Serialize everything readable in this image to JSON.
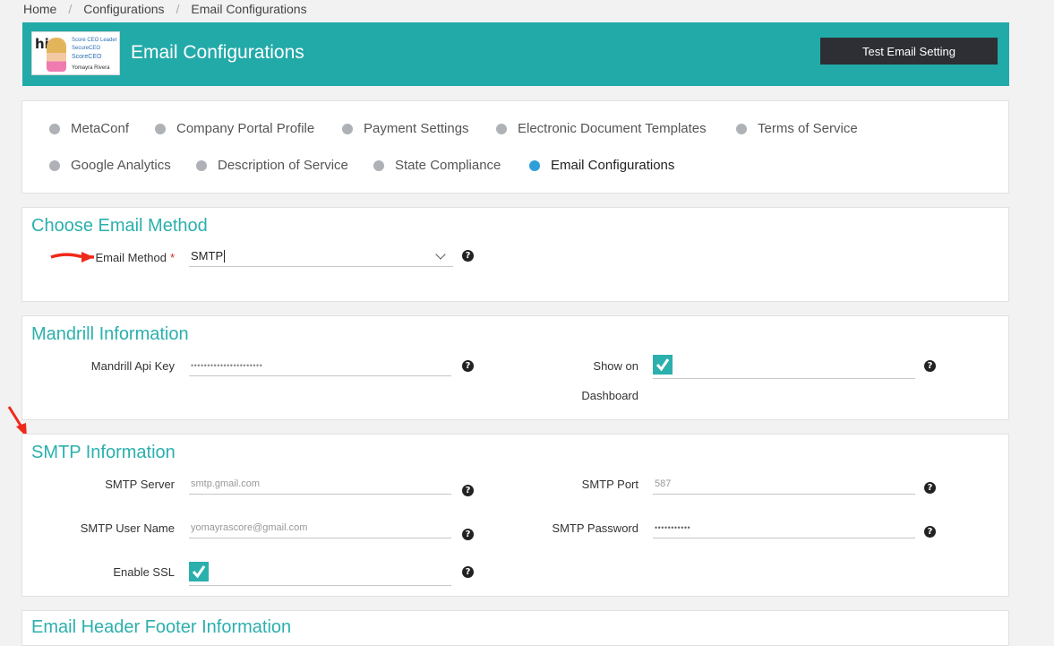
{
  "breadcrumb": {
    "home": "Home",
    "configurations": "Configurations",
    "current": "Email Configurations"
  },
  "header": {
    "title": "Email Configurations",
    "test_button": "Test Email Setting",
    "accent_color": "#22aaa8",
    "logo": {
      "hi": "hi",
      "line1": "Score CEO Leader",
      "line2": "SecureCEO",
      "line3": "ScoreCEO",
      "line4": "Yomayra Rivera"
    }
  },
  "nav": {
    "items": [
      {
        "label": "MetaConf",
        "active": false
      },
      {
        "label": "Company Portal Profile",
        "active": false
      },
      {
        "label": "Payment Settings",
        "active": false
      },
      {
        "label": "Electronic Document Templates",
        "active": false
      },
      {
        "label": "Terms of Service",
        "active": false
      },
      {
        "label": "Google Analytics",
        "active": false
      },
      {
        "label": "Description of Service",
        "active": false
      },
      {
        "label": "State Compliance",
        "active": false
      },
      {
        "label": "Email Configurations",
        "active": true
      }
    ]
  },
  "email_method": {
    "section_title": "Choose Email Method",
    "label": "Email Method",
    "required_mark": "*",
    "value": "SMTP"
  },
  "mandrill": {
    "section_title": "Mandrill Information",
    "api_key_label": "Mandrill Api Key",
    "api_key_value": "••••••••••••••••••••••",
    "show_on_label_line1": "Show on",
    "show_on_label_line2": "Dashboard",
    "show_on_checked": true
  },
  "smtp": {
    "section_title": "SMTP Information",
    "server_label": "SMTP Server",
    "server_placeholder": "smtp.gmail.com",
    "port_label": "SMTP Port",
    "port_placeholder": "587",
    "user_label": "SMTP User Name",
    "user_placeholder": "yomayrascore@gmail.com",
    "password_label": "SMTP Password",
    "password_value": "•••••••••••",
    "ssl_label": "Enable SSL",
    "ssl_checked": true
  },
  "next_section": {
    "title": "Email Header Footer Information"
  },
  "help_glyph": "?"
}
